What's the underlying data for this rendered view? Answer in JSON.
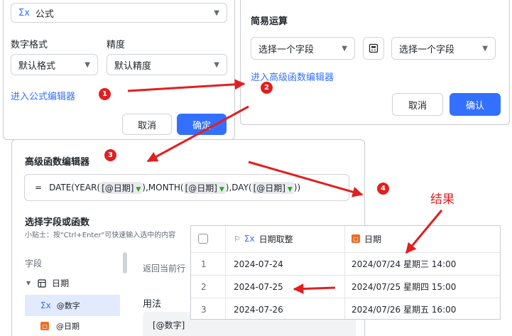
{
  "panel1": {
    "formula_select": "公式",
    "formula_icon": "Σx",
    "number_format_label": "数字格式",
    "number_format_value": "默认格式",
    "precision_label": "精度",
    "precision_value": "默认精度",
    "enter_formula_editor": "进入公式编辑器",
    "cancel": "取消",
    "confirm": "确定"
  },
  "panel2": {
    "title": "简易运算",
    "field_select_1": "选择一个字段",
    "field_select_2": "选择一个字段",
    "operator_icon": "calculator-icon",
    "enter_advanced_editor": "进入高级函数编辑器",
    "cancel": "取消",
    "confirm": "确认"
  },
  "panel3": {
    "title": "高级函数编辑器",
    "formula": {
      "eq": "=",
      "p1": "DATE(YEAR(",
      "chip1": "[@日期]",
      "p2": "),MONTH(",
      "chip2": "[@日期]",
      "p3": "),DAY(",
      "chip3": "[@日期]",
      "p4": "))"
    },
    "select_title": "选择字段或函数",
    "tip": "小贴士：按\"Ctrl+Enter\"可快速输入选中的内容",
    "field_header": "字段",
    "tree_group": "日期",
    "tree_item_1": "@数字",
    "tree_item_2": "@日期",
    "return_text": "返回当前行",
    "usage_label": "用法",
    "usage_code": "[@数字]"
  },
  "annotations": {
    "badge1": "1",
    "badge2": "2",
    "badge3": "3",
    "badge4": "4",
    "result_label": "结果",
    "arrow_color": "#e02020"
  },
  "result_table": {
    "columns": [
      "日期取整",
      "日期"
    ],
    "rows": [
      {
        "index": "1",
        "rounded": "2024-07-24",
        "date": "2024/07/24 星期三 14:00"
      },
      {
        "index": "2",
        "rounded": "2024-07-25",
        "date": "2024/07/25 星期四 15:00"
      },
      {
        "index": "3",
        "rounded": "2024-07-26",
        "date": "2024/07/26 星期五 16:00"
      }
    ]
  }
}
